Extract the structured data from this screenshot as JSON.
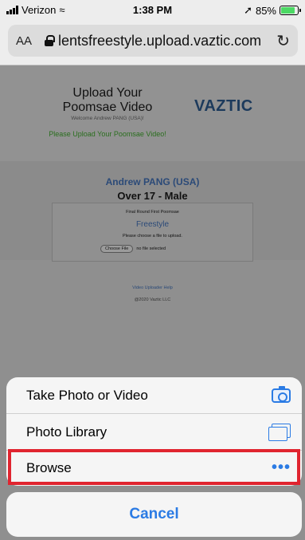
{
  "status_bar": {
    "carrier": "Verizon",
    "time": "1:38 PM",
    "battery": "85%"
  },
  "browser": {
    "text_size_label": "AA",
    "url": "lentsfreestyle.upload.vaztic.com"
  },
  "page": {
    "title": "Upload Your Poomsae Video",
    "welcome": "Welcome Andrew PANG (USA)!",
    "upload_message": "Please Upload Your Poomsae Video!",
    "logo_text": "VAZTIC",
    "athlete": "Andrew PANG (USA)",
    "division": "Over 17 - Male",
    "round": "Final Round First Poomsae",
    "style": "Freestyle",
    "choose_prompt": "Please choose a file to upload.",
    "choose_button": "Choose File",
    "file_status": "no file selected",
    "help_link": "Video Uploader Help",
    "copyright": "@2020 Vaztic LLC"
  },
  "action_sheet": {
    "items": [
      {
        "label": "Take Photo or Video",
        "icon": "camera-icon"
      },
      {
        "label": "Photo Library",
        "icon": "photo-library-icon"
      },
      {
        "label": "Browse",
        "icon": "more-icon"
      }
    ],
    "cancel_label": "Cancel"
  },
  "colors": {
    "accent": "#2b7be4",
    "highlight": "#e0242f"
  }
}
